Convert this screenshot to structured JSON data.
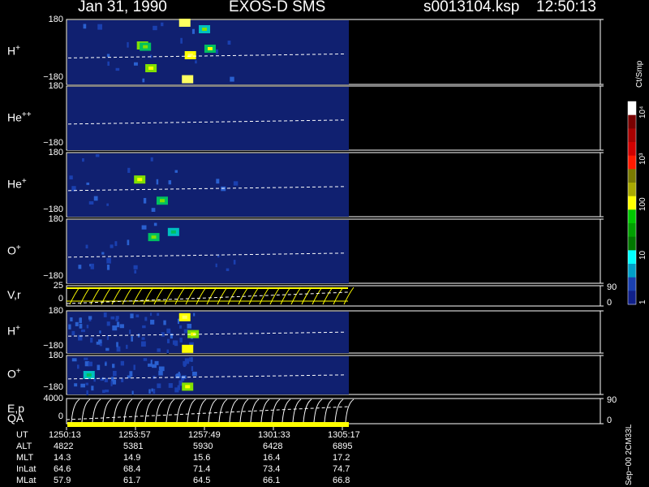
{
  "header": {
    "date": "Jan 31, 1990",
    "instrument": "EXOS-D SMS",
    "file": "s0013104.ksp",
    "time": "12:50:13"
  },
  "panels": [
    {
      "key": "h1",
      "label": "H",
      "sup": "+",
      "ymax": "180",
      "ymin": "−180"
    },
    {
      "key": "he2",
      "label": "He",
      "sup": "++",
      "ymax": "180",
      "ymin": "−180"
    },
    {
      "key": "he1",
      "label": "He",
      "sup": "+",
      "ymax": "180",
      "ymin": "−180"
    },
    {
      "key": "o1",
      "label": "O",
      "sup": "+",
      "ymax": "180",
      "ymin": "−180"
    },
    {
      "key": "vr",
      "label": "V,r",
      "sup": "",
      "ymax": "25",
      "ymin": "0",
      "rmax": "90",
      "rmin": "0"
    },
    {
      "key": "h2",
      "label": "H",
      "sup": "+",
      "ymax": "180",
      "ymin": "−180"
    },
    {
      "key": "o2",
      "label": "O",
      "sup": "+",
      "ymax": "180",
      "ymin": "−180"
    },
    {
      "key": "ep",
      "label": "E,p",
      "sup": "",
      "ymax": "4000",
      "ymin": "0",
      "rmax": "90",
      "rmin": "0"
    }
  ],
  "qa_label": "QA",
  "colorbar": {
    "unit": "Ct/Smp",
    "labels": [
      "10⁴",
      "10³",
      "100",
      "10",
      "1"
    ],
    "colors": [
      "#ffffff",
      "#7a0000",
      "#a80000",
      "#d00000",
      "#ff1a00",
      "#7a7a00",
      "#a8a800",
      "#ffff00",
      "#00c800",
      "#00a000",
      "#007800",
      "#00ffff",
      "#00a0c8",
      "#1a40b0",
      "#10208a"
    ]
  },
  "orbit_table": {
    "rows": [
      {
        "name": "UT",
        "values": [
          "1250:13",
          "1253:57",
          "1257:49",
          "1301:33",
          "1305:17"
        ]
      },
      {
        "name": "ALT",
        "values": [
          "4822",
          "5381",
          "5930",
          "6428",
          "6895"
        ]
      },
      {
        "name": "MLT",
        "values": [
          "14.3",
          "14.9",
          "15.6",
          "16.4",
          "17.2"
        ]
      },
      {
        "name": "InLat",
        "values": [
          "64.6",
          "68.4",
          "71.4",
          "73.4",
          "74.7"
        ]
      },
      {
        "name": "MLat",
        "values": [
          "57.9",
          "61.7",
          "64.5",
          "66.1",
          "66.8"
        ]
      }
    ]
  },
  "footer_code": "Sep−00 2CM33L",
  "chart_data": {
    "type": "heatmap",
    "title": "Jan 31, 1990   EXOS-D SMS",
    "x_ticks": [
      "1250:13",
      "1253:57",
      "1257:49",
      "1301:33",
      "1305:17"
    ],
    "colorbar_label": "Ct/Smp",
    "colorbar_ticks": [
      "1",
      "10",
      "100",
      "10³",
      "10⁴"
    ],
    "panels": [
      {
        "name": "H+",
        "ylim": [
          -180,
          180
        ],
        "patches": [
          [
            0.27,
            0.6,
            120
          ],
          [
            0.28,
            0.58,
            40
          ],
          [
            0.42,
            0.95,
            800
          ],
          [
            0.43,
            0.08,
            600
          ],
          [
            0.44,
            0.45,
            200
          ],
          [
            0.51,
            0.55,
            60
          ],
          [
            0.49,
            0.85,
            30
          ],
          [
            0.3,
            0.25,
            100
          ]
        ]
      },
      {
        "name": "He++",
        "ylim": [
          -180,
          180
        ],
        "patches": []
      },
      {
        "name": "He+",
        "ylim": [
          -180,
          180
        ],
        "patches": [
          [
            0.26,
            0.58,
            120
          ],
          [
            0.34,
            0.25,
            40
          ]
        ]
      },
      {
        "name": "O+",
        "ylim": [
          -180,
          180
        ],
        "patches": [
          [
            0.31,
            0.72,
            40
          ],
          [
            0.38,
            0.8,
            25
          ]
        ]
      },
      {
        "name": "H+",
        "ylim": [
          -180,
          180
        ],
        "patches": [
          [
            0.42,
            0.85,
            200
          ],
          [
            0.45,
            0.45,
            80
          ],
          [
            0.43,
            0.1,
            150
          ]
        ]
      },
      {
        "name": "O+",
        "ylim": [
          -180,
          180
        ],
        "patches": [
          [
            0.43,
            0.2,
            80
          ],
          [
            0.08,
            0.5,
            20
          ]
        ]
      }
    ]
  }
}
